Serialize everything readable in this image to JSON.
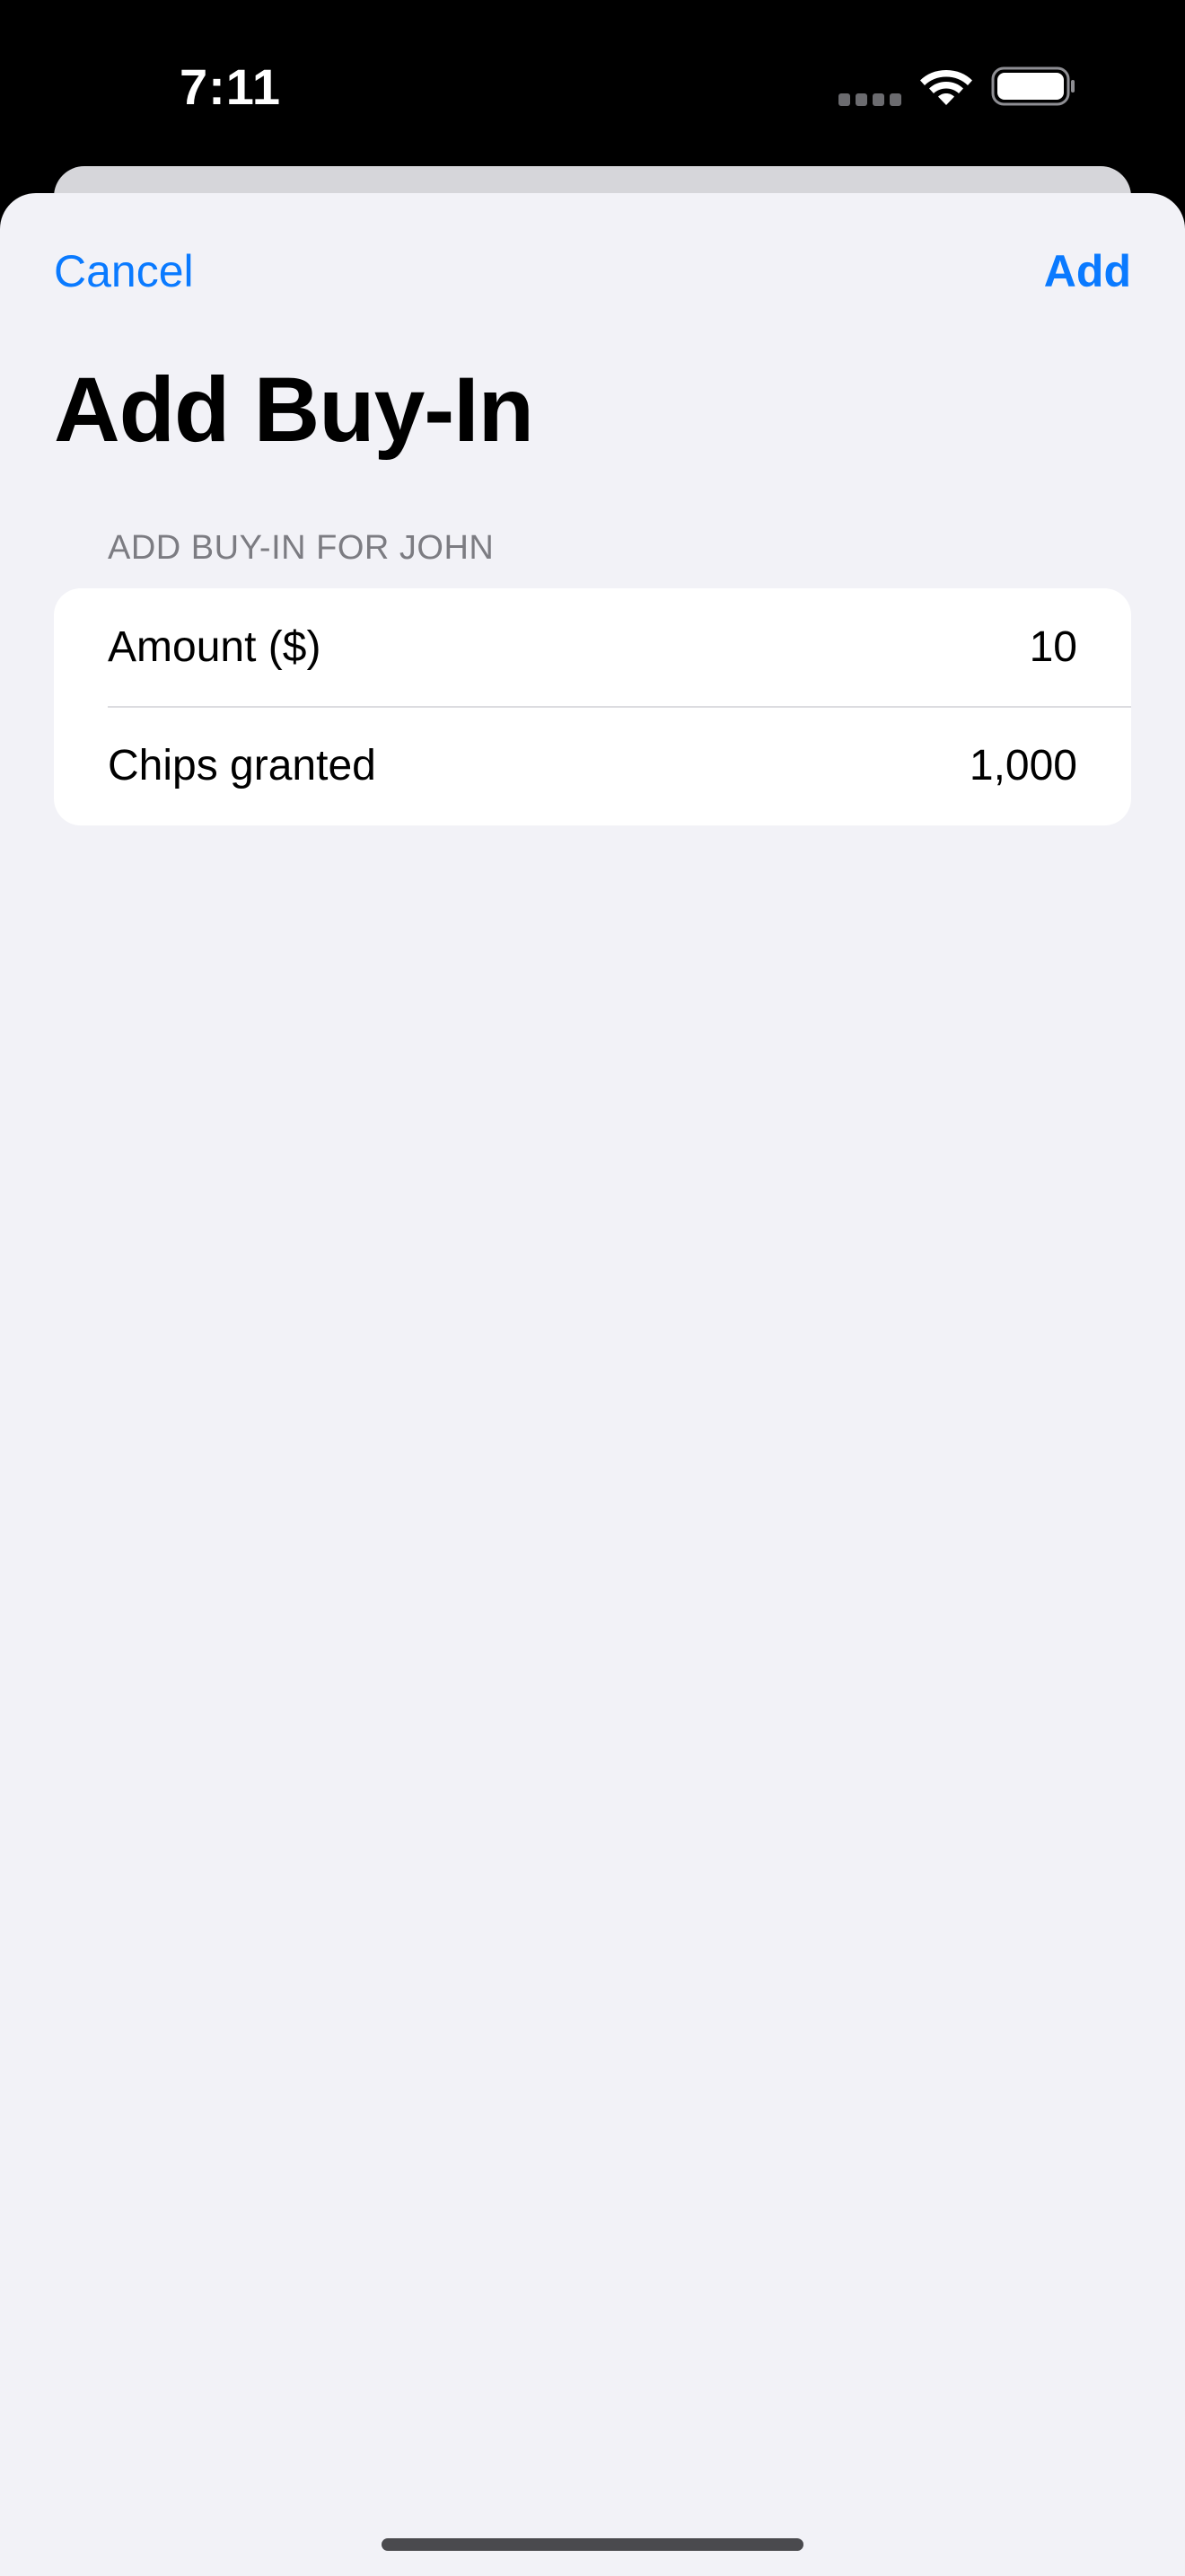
{
  "status_bar": {
    "time": "7:11",
    "icons": [
      "cellular-signal-icon",
      "wifi-icon",
      "battery-icon"
    ]
  },
  "nav": {
    "cancel_label": "Cancel",
    "add_label": "Add"
  },
  "title": "Add Buy-In",
  "section": {
    "header": "ADD BUY-IN FOR JOHN"
  },
  "form": {
    "rows": [
      {
        "label": "Amount ($)",
        "value": "10"
      },
      {
        "label": "Chips granted",
        "value": "1,000"
      }
    ]
  },
  "colors": {
    "accent": "#0a7aff",
    "sheet_background": "#f2f2f7",
    "card_background": "#ffffff",
    "section_header": "#7c7c82"
  }
}
